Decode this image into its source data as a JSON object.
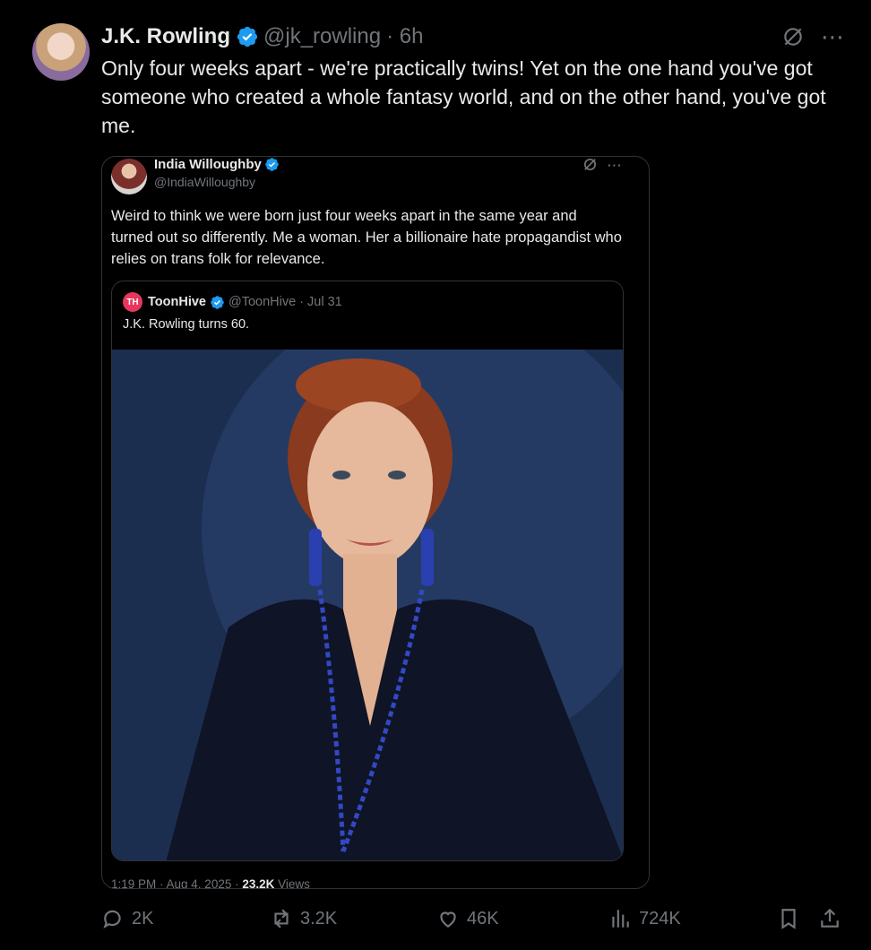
{
  "tweet": {
    "name": "J.K. Rowling",
    "handle": "@jk_rowling",
    "time": "· 6h",
    "text": "Only four weeks apart - we're practically twins! Yet on the one hand you've got someone who created a whole fantasy world, and on the other hand, you've got me."
  },
  "quote": {
    "name": "India Willoughby",
    "handle": "@IndiaWilloughby",
    "text": "Weird to think we were born just four weeks apart in the same year and turned out so differently. Me a woman. Her a billionaire hate propagandist who relies on trans folk for relevance.",
    "footer_time": "1:19 PM · Aug 4, 2025 ·",
    "footer_views": "23.2K",
    "footer_views_label": "Views",
    "inner": {
      "logo_text": "TH",
      "name": "ToonHive",
      "handle": "@ToonHive · Jul 31",
      "text": "J.K. Rowling turns 60."
    }
  },
  "actions": {
    "replies": "2K",
    "reposts": "3.2K",
    "likes": "46K",
    "views": "724K"
  },
  "icons": [
    "grok-icon",
    "more-icon",
    "verified-icon",
    "reply-icon",
    "repost-icon",
    "like-icon",
    "views-icon",
    "bookmark-icon",
    "share-icon"
  ],
  "colors": {
    "background": "#000000",
    "text": "#e7e9ea",
    "muted": "#71767b",
    "verified": "#1d9bf0",
    "border": "#2f3336"
  }
}
